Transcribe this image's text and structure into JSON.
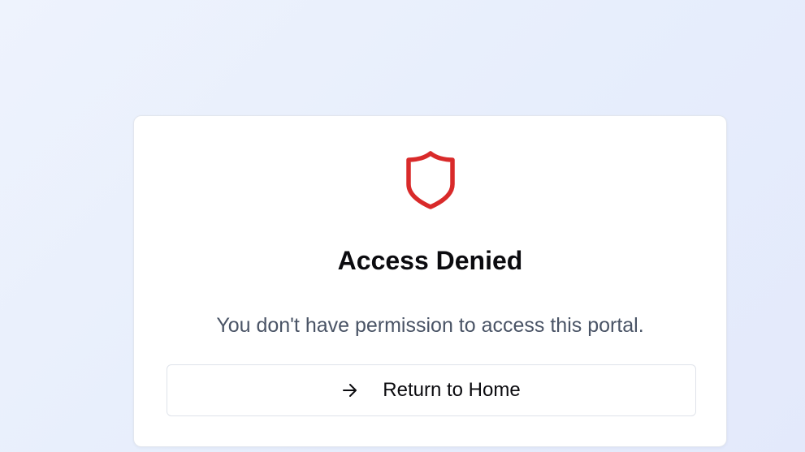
{
  "card": {
    "title": "Access Denied",
    "message": "You don't have permission to access this portal.",
    "icon": "shield-icon"
  },
  "actions": {
    "home_label": "Return to Home",
    "home_icon": "arrow-right-icon"
  },
  "colors": {
    "accent": "#d92a2a",
    "background": "#e8eefc",
    "card": "#ffffff",
    "text": "#0b0b0f",
    "muted_text": "#4a5466"
  }
}
